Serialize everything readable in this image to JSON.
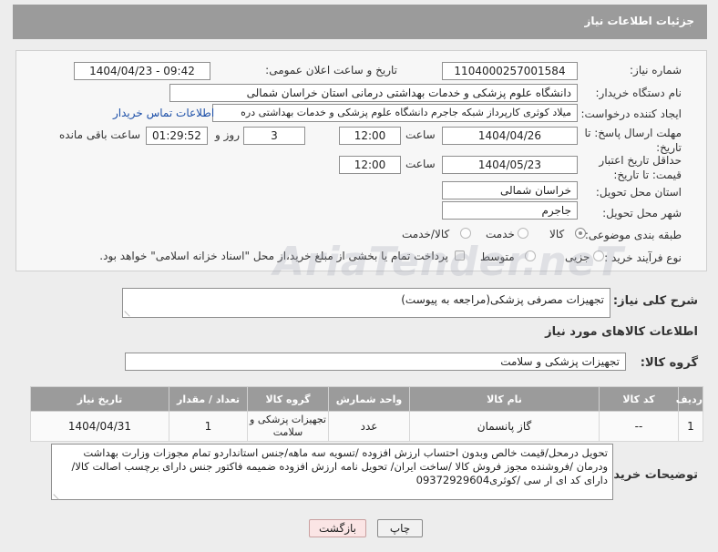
{
  "header": {
    "title": "جزئیات اطلاعات نیاز"
  },
  "fields": {
    "need_number": {
      "label": "شماره نیاز:",
      "value": "1104000257001584"
    },
    "announce_datetime": {
      "label": "تاریخ و ساعت اعلان عمومی:",
      "value": "1404/04/23 - 09:42"
    },
    "buyer_org": {
      "label": "نام دستگاه خریدار:",
      "value": "دانشگاه علوم پزشکی و خدمات بهداشتی درمانی استان خراسان شمالی"
    },
    "requester": {
      "label": "ایجاد کننده درخواست:",
      "value": "میلاد کوثری کارپرداز شبکه جاجرم دانشگاه علوم پزشکی و خدمات بهداشتی دره",
      "contact_link": "اطلاعات تماس خریدار"
    },
    "reply_deadline": {
      "label": "مهلت ارسال پاسخ: تا تاریخ:",
      "date": "1404/04/26",
      "time_label": "ساعت",
      "time": "12:00",
      "days": "3",
      "days_label": "روز و",
      "remaining": "01:29:52",
      "remaining_label": "ساعت باقی مانده"
    },
    "price_validity": {
      "label": "حداقل تاریخ اعتبار قیمت: تا تاریخ:",
      "date": "1404/05/23",
      "time_label": "ساعت",
      "time": "12:00"
    },
    "delivery_province": {
      "label": "استان محل تحویل:",
      "value": "خراسان شمالی"
    },
    "delivery_city": {
      "label": "شهر محل تحویل:",
      "value": "جاجرم"
    },
    "subject_category": {
      "label": "طبقه بندی موضوعی:",
      "options": [
        "کالا",
        "خدمت",
        "کالا/خدمت"
      ],
      "selected": "کالا"
    },
    "purchase_process": {
      "label": "نوع فرآیند خرید :",
      "options": [
        "جزیی",
        "متوسط"
      ],
      "payment_note": "پرداخت تمام یا بخشی از مبلغ خرید،از محل \"اسناد خزانه اسلامی\" خواهد بود."
    }
  },
  "watermark": "AriaTender.neT",
  "description": {
    "label": "شرح کلی نیاز:",
    "value": "تجهیزات مصرفی پزشکی(مراجعه به پیوست)"
  },
  "goods_section": {
    "title": "اطلاعات کالاهای مورد نیاز"
  },
  "goods_group": {
    "label": "گروه کالا:",
    "value": "تجهیزات پزشکی و سلامت"
  },
  "table": {
    "headers": [
      "ردیف",
      "کد کالا",
      "نام کالا",
      "واحد شمارش",
      "گروه کالا",
      "تعداد / مقدار",
      "تاریخ نیاز"
    ],
    "rows": [
      [
        "1",
        "--",
        "گاز پانسمان",
        "عدد",
        "تجهیزات پزشکی و سلامت",
        "1",
        "1404/04/31"
      ]
    ]
  },
  "buyer_notes": {
    "label": "توضیحات خریدار:",
    "value": "تحویل درمحل/قیمت خالص وبدون احتساب ارزش افزوده /تسویه سه ماهه/جنس استانداردو تمام مجوزات وزارت بهداشت ودرمان /فروشنده مجوز فروش کالا /ساخت ایران/ تحویل  نامه ارزش افزوده ضمیمه  فاکتور جنس دارای برچسب اصالت کالا/دارای کد ای ار سی  /کوثری09372929604"
  },
  "buttons": {
    "print": "چاپ",
    "back": "بازگشت"
  }
}
